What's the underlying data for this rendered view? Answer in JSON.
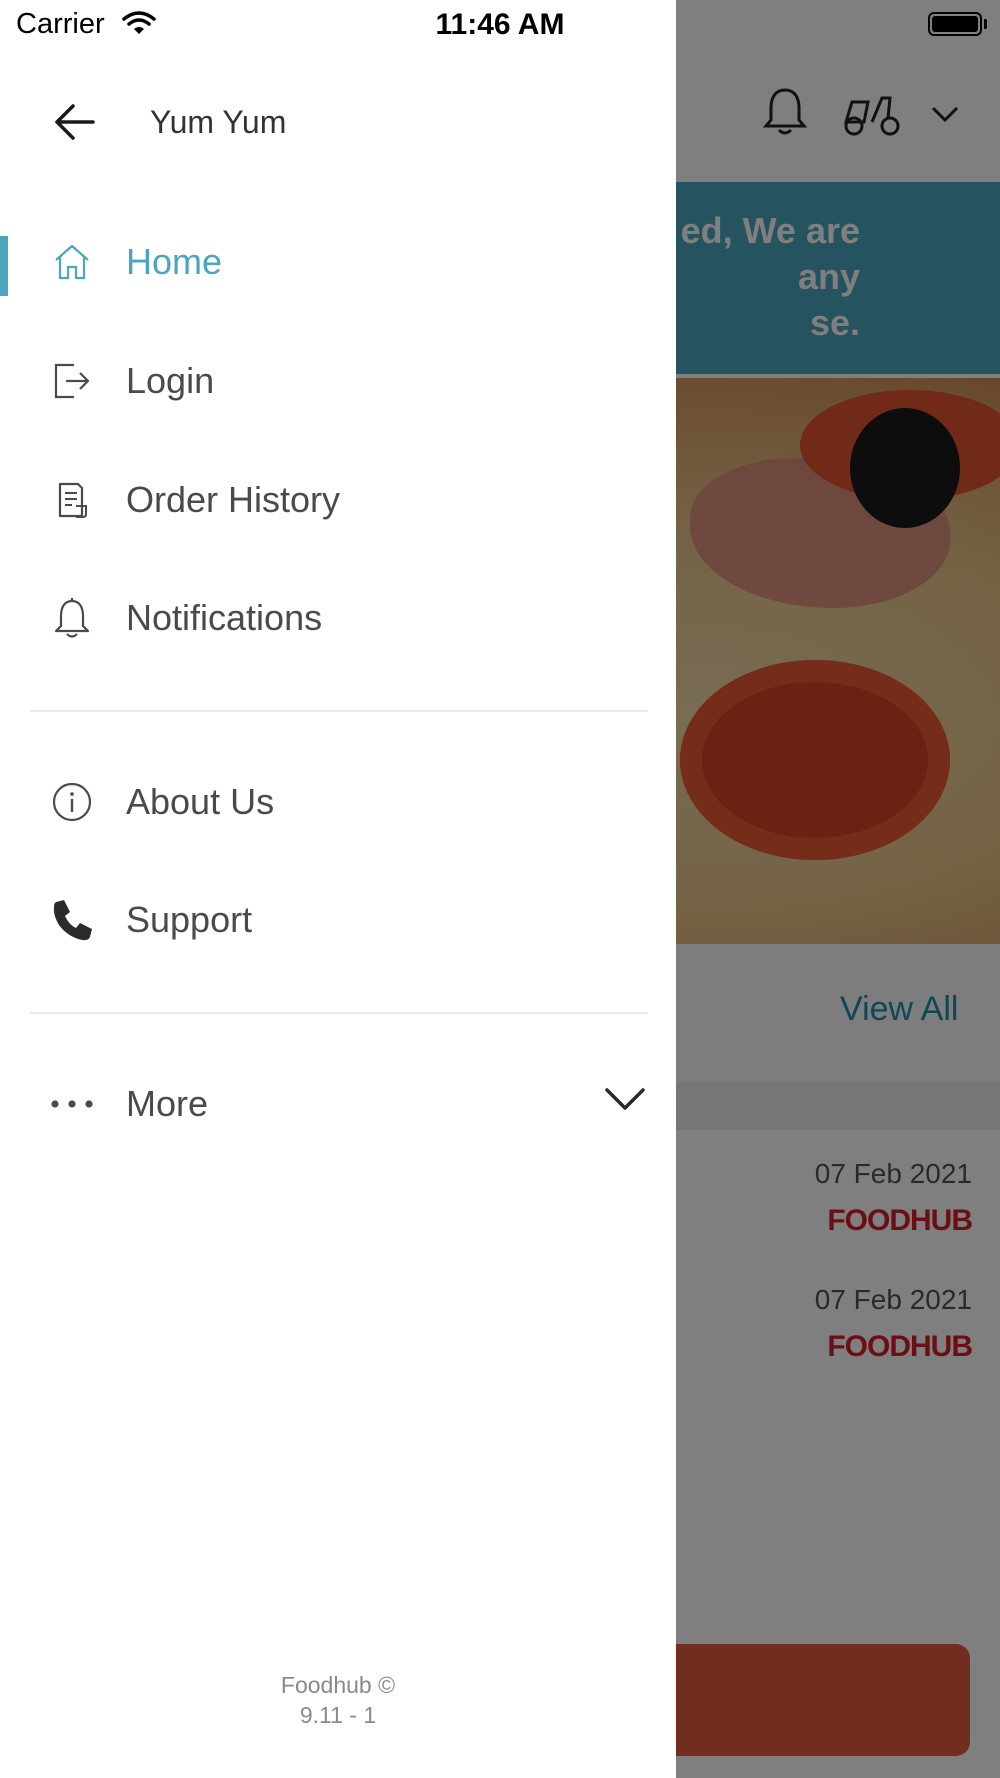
{
  "status_bar": {
    "carrier": "Carrier",
    "time": "11:46 AM"
  },
  "drawer": {
    "title": "Yum Yum",
    "primary_items": [
      {
        "label": "Home",
        "icon": "home-icon",
        "active": true
      },
      {
        "label": "Login",
        "icon": "login-icon"
      },
      {
        "label": "Order History",
        "icon": "order-history-icon"
      },
      {
        "label": "Notifications",
        "icon": "bell-icon"
      }
    ],
    "secondary_items": [
      {
        "label": "About Us",
        "icon": "info-icon"
      },
      {
        "label": "Support",
        "icon": "phone-icon"
      }
    ],
    "more": {
      "label": "More",
      "icon": "more-dots-icon"
    },
    "footer": {
      "brand": "Foodhub ©",
      "version": "9.11 - 1"
    }
  },
  "background": {
    "banner_text": "ed, We are\nany\nse.",
    "view_all": "View All",
    "list": [
      {
        "date": "07 Feb 2021",
        "logo": "FOODHUB"
      },
      {
        "date": "07 Feb 2021",
        "logo": "FOODHUB"
      }
    ]
  },
  "colors": {
    "accent": "#4aa6bf",
    "text": "#4a4a4a",
    "brand_red": "#d81e2a"
  }
}
